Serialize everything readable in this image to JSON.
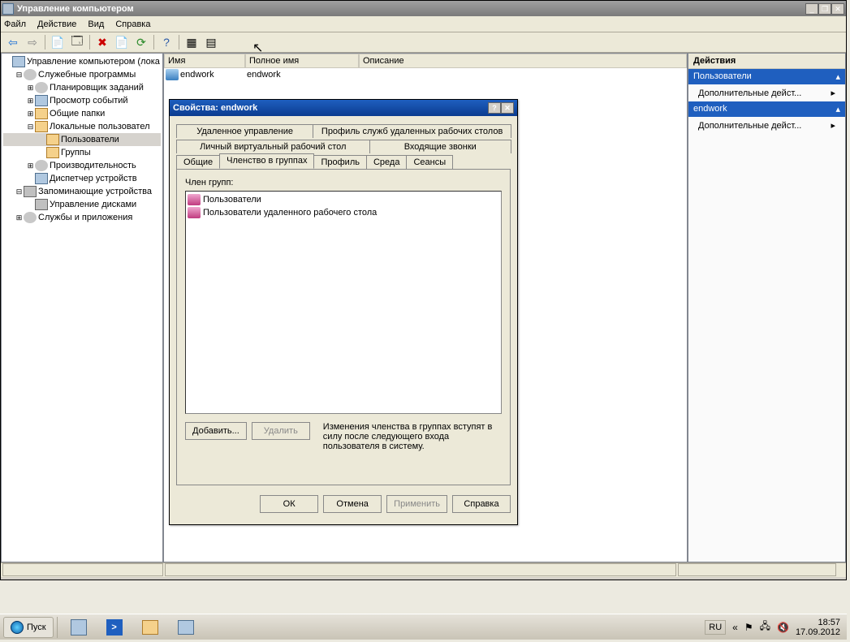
{
  "window": {
    "title": "Управление компьютером",
    "min": "_",
    "max": "❐",
    "close": "✕"
  },
  "menu": {
    "file": "Файл",
    "action": "Действие",
    "view": "Вид",
    "help": "Справка"
  },
  "tree": {
    "root": "Управление компьютером (лока",
    "sys": "Служебные программы",
    "sched": "Планировщик заданий",
    "event": "Просмотр событий",
    "shared": "Общие папки",
    "local": "Локальные пользовател",
    "users": "Пользователи",
    "groups": "Группы",
    "perf": "Производительность",
    "devmgr": "Диспетчер устройств",
    "storage": "Запоминающие устройства",
    "diskmgmt": "Управление дисками",
    "services": "Службы и приложения"
  },
  "list": {
    "col_name": "Имя",
    "col_full": "Полное имя",
    "col_desc": "Описание",
    "row_name": "endwork",
    "row_full": "endwork"
  },
  "actions": {
    "header": "Действия",
    "users_sec": "Пользователи",
    "more": "Дополнительные дейст...",
    "endwork_sec": "endwork"
  },
  "dialog": {
    "title": "Свойства: endwork",
    "tabs": {
      "remote": "Удаленное управление",
      "rds_profile": "Профиль служб удаленных рабочих столов",
      "pvd": "Личный виртуальный рабочий стол",
      "calls": "Входящие звонки",
      "general": "Общие",
      "member": "Членство в группах",
      "profile": "Профиль",
      "env": "Среда",
      "sessions": "Сеансы"
    },
    "member_label": "Член групп:",
    "groups": [
      "Пользователи",
      "Пользователи удаленного рабочего стола"
    ],
    "add": "Добавить...",
    "remove": "Удалить",
    "note": "Изменения членства в группах вступят в силу после следующего входа пользователя в систему.",
    "ok": "ОК",
    "cancel": "Отмена",
    "apply": "Применить",
    "help": "Справка",
    "help_btn": "?",
    "close_btn": "✕"
  },
  "taskbar": {
    "start": "Пуск",
    "lang": "RU",
    "time": "18:57",
    "date": "17.09.2012"
  }
}
